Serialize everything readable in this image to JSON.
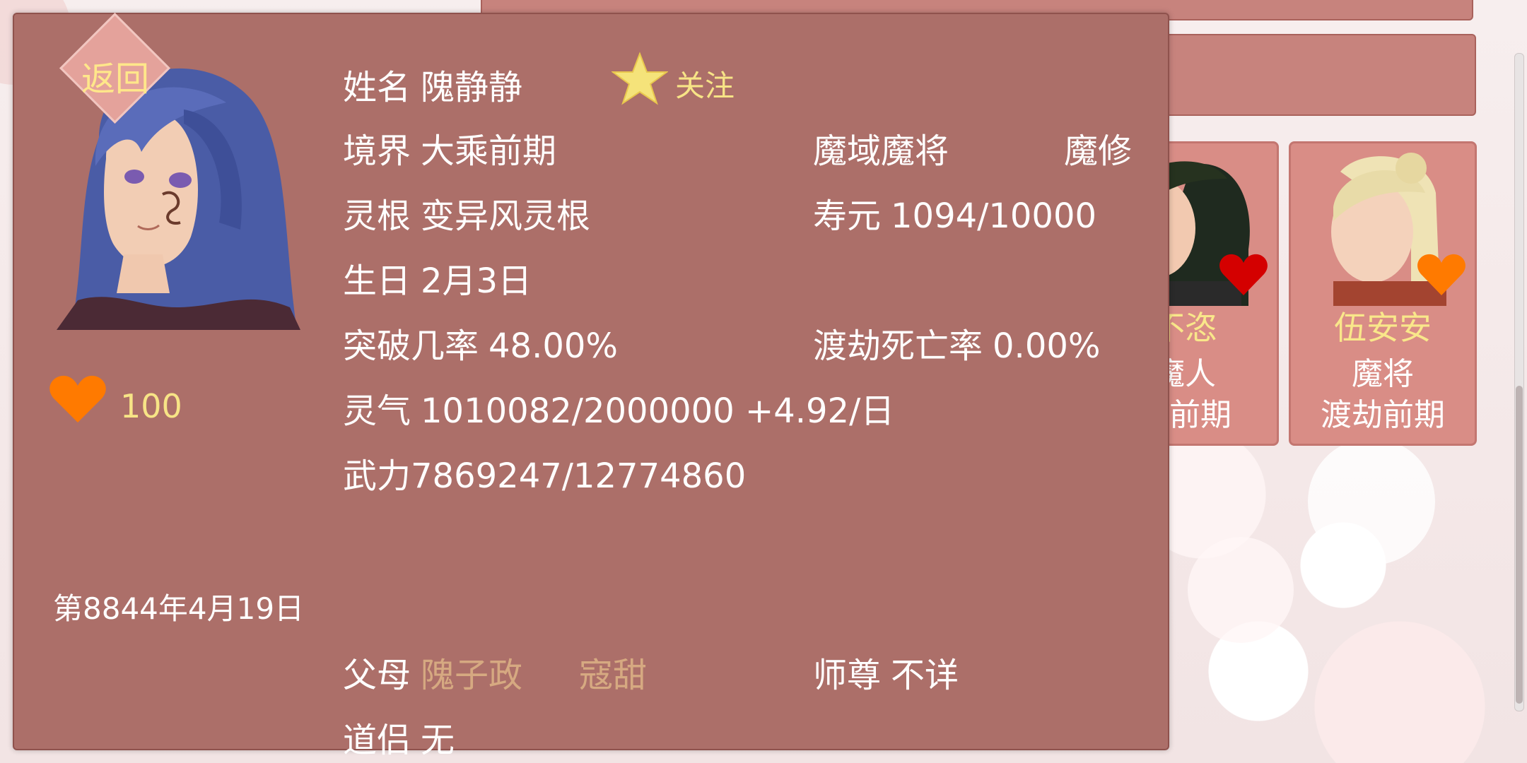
{
  "popup": {
    "back_label": "返回",
    "name_label": "姓名",
    "name_value": "隗静静",
    "follow_label": "关注",
    "realm_label": "境界",
    "realm_value": "大乘前期",
    "faction": "魔域魔将",
    "path": "魔修",
    "root_label": "灵根",
    "root_value": "变异风灵根",
    "lifespan_label": "寿元",
    "lifespan_value": "1094/10000",
    "birthday_label": "生日",
    "birthday_value": "2月3日",
    "breakthrough_label": "突破几率",
    "breakthrough_value": "48.00%",
    "tribulation_label": "渡劫死亡率",
    "tribulation_value": "0.00%",
    "qi_label": "灵气",
    "qi_value": "1010082/2000000 +4.92/日",
    "power_text": "武力7869247/12774860",
    "affection": "100",
    "date": "第8844年4月19日",
    "parents_label": "父母",
    "father": "隗子政",
    "mother": "寇甜",
    "master_label": "师尊",
    "master_value": "不详",
    "partner_label": "道侣",
    "partner_value": "无"
  },
  "background": {
    "cards": [
      {
        "name": "不恣",
        "line1": "魔人",
        "line2": "劫前期"
      },
      {
        "name": "伍安安",
        "line1": "魔将",
        "line2": "渡劫前期"
      }
    ]
  },
  "colors": {
    "panel": "#ac6f69",
    "accent_yellow": "#f7e486",
    "parent_text": "#d6a981",
    "heart_orange": "#ff7a00",
    "heart_red": "#d40000"
  },
  "icons": [
    "back-diamond",
    "star-icon",
    "heart-icon"
  ]
}
